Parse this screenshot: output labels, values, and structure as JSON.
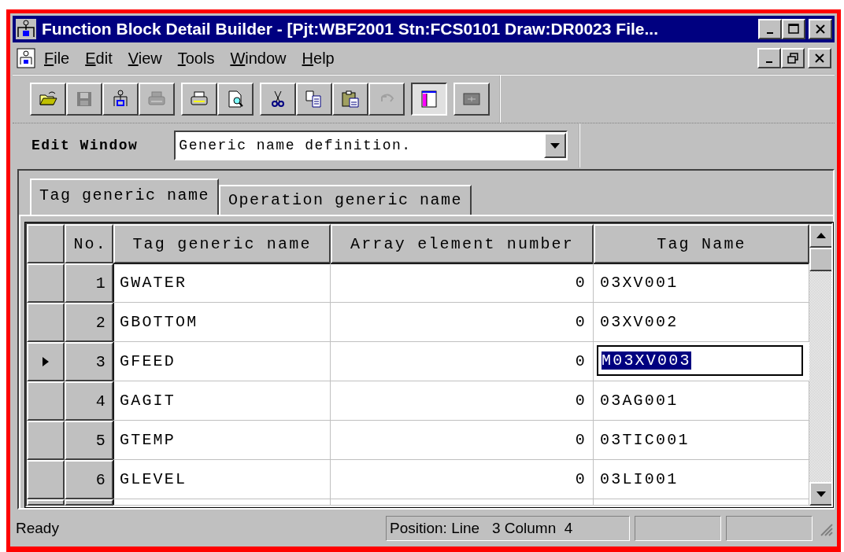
{
  "window": {
    "title": "Function Block Detail Builder - [Pjt:WBF2001 Stn:FCS0101 Draw:DR0023 File..."
  },
  "menu": [
    {
      "label": "File"
    },
    {
      "label": "Edit"
    },
    {
      "label": "View"
    },
    {
      "label": "Tools"
    },
    {
      "label": "Window"
    },
    {
      "label": "Help"
    }
  ],
  "toolbar": [
    {
      "kind": "open",
      "disabled": false,
      "pressed": false
    },
    {
      "kind": "save",
      "disabled": true,
      "pressed": false
    },
    {
      "kind": "block",
      "disabled": false,
      "pressed": false
    },
    {
      "kind": "print",
      "disabled": true,
      "pressed": false
    },
    {
      "sep": true,
      "kind": "print",
      "disabled": false,
      "pressed": false
    },
    {
      "kind": "preview",
      "disabled": false,
      "pressed": false
    },
    {
      "sep": true,
      "kind": "cut",
      "disabled": false,
      "pressed": false
    },
    {
      "kind": "copy",
      "disabled": false,
      "pressed": false
    },
    {
      "kind": "paste",
      "disabled": false,
      "pressed": false
    },
    {
      "kind": "undo",
      "disabled": true,
      "pressed": false
    },
    {
      "sep": true,
      "kind": "panel",
      "disabled": false,
      "pressed": true
    },
    {
      "sep": true,
      "kind": "split",
      "disabled": true,
      "pressed": false
    }
  ],
  "edit_window": {
    "label": "Edit Window",
    "value": "Generic name definition."
  },
  "tabs": [
    {
      "label": "Tag generic name",
      "selected": true
    },
    {
      "label": "Operation generic name",
      "selected": false
    }
  ],
  "table": {
    "columns": [
      "No.",
      "Tag generic name",
      "Array element number",
      "Tag Name"
    ],
    "rows": [
      {
        "no": "1",
        "tag_generic_name": "GWATER",
        "array_element_number": "0",
        "tag_name": "03XV001",
        "selected": false,
        "editing": false
      },
      {
        "no": "2",
        "tag_generic_name": "GBOTTOM",
        "array_element_number": "0",
        "tag_name": "03XV002",
        "selected": false,
        "editing": false
      },
      {
        "no": "3",
        "tag_generic_name": "GFEED",
        "array_element_number": "0",
        "tag_name": "M03XV003",
        "selected": true,
        "editing": true
      },
      {
        "no": "4",
        "tag_generic_name": "GAGIT",
        "array_element_number": "0",
        "tag_name": "03AG001",
        "selected": false,
        "editing": false
      },
      {
        "no": "5",
        "tag_generic_name": "GTEMP",
        "array_element_number": "0",
        "tag_name": "03TIC001",
        "selected": false,
        "editing": false
      },
      {
        "no": "6",
        "tag_generic_name": "GLEVEL",
        "array_element_number": "0",
        "tag_name": "03LI001",
        "selected": false,
        "editing": false
      }
    ]
  },
  "status_bar": {
    "message": "Ready",
    "position": "Position: Line   3 Column  4"
  }
}
